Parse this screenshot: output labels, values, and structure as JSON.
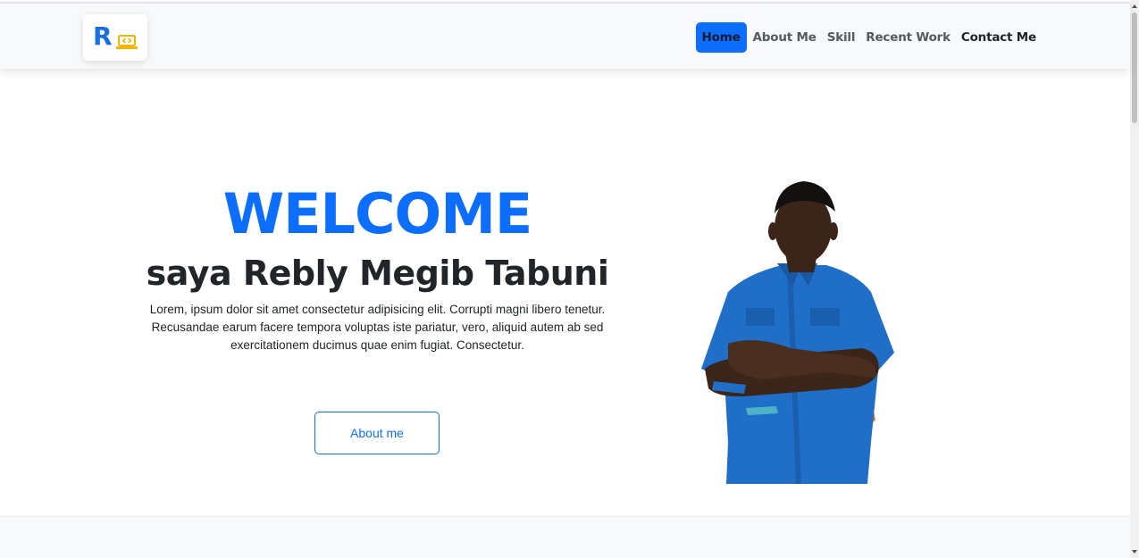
{
  "brand": {
    "letter": "R",
    "icon": "laptop-code-icon",
    "letter_color": "#1a6fe0",
    "icon_color": "#f4b400"
  },
  "nav": {
    "items": [
      {
        "label": "Home",
        "active": true
      },
      {
        "label": "About Me",
        "active": false
      },
      {
        "label": "Skill",
        "active": false
      },
      {
        "label": "Recent Work",
        "active": false
      },
      {
        "label": "Contact Me",
        "active": false
      }
    ]
  },
  "hero": {
    "welcome": "WELCOME",
    "name": "saya Rebly Megib Tabuni",
    "intro": "Lorem, ipsum dolor sit amet consectetur adipisicing elit. Corrupti magni libero tenetur. Recusandae earum facere tempora voluptas iste pariatur, vero, aliquid autem ab sed exercitationem ducimus quae enim fugiat. Consectetur.",
    "button_label": "About me",
    "photo": "profile-photo"
  },
  "colors": {
    "primary": "#0d6efd",
    "navbar_bg": "#f8f9fa",
    "text": "#212529"
  }
}
